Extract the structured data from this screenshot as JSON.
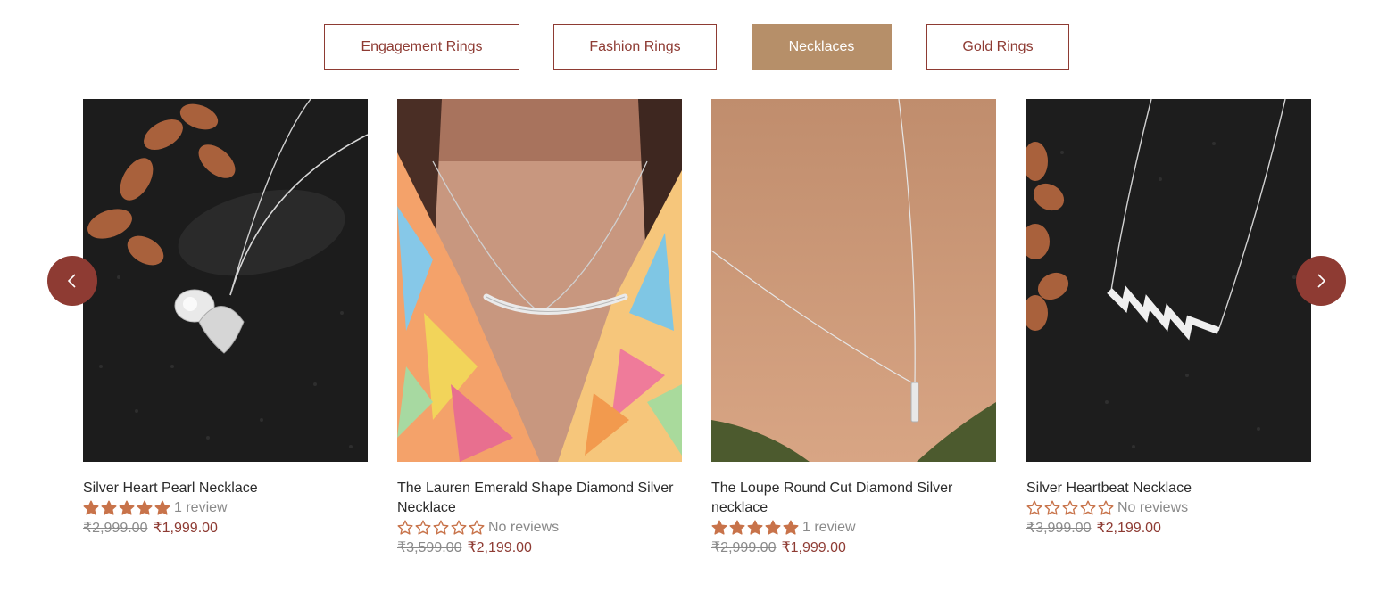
{
  "tabs": [
    {
      "label": "Engagement Rings",
      "active": false
    },
    {
      "label": "Fashion Rings",
      "active": false
    },
    {
      "label": "Necklaces",
      "active": true
    },
    {
      "label": "Gold Rings",
      "active": false
    }
  ],
  "products": [
    {
      "title": "Silver Heart Pearl Necklace",
      "rating": 5,
      "reviews": "1 review",
      "old_price": "₹2,999.00",
      "price": "₹1,999.00"
    },
    {
      "title": "The Lauren Emerald Shape Diamond Silver Necklace",
      "rating": 0,
      "reviews": "No reviews",
      "old_price": "₹3,599.00",
      "price": "₹2,199.00"
    },
    {
      "title": "The Loupe Round Cut Diamond Silver necklace",
      "rating": 5,
      "reviews": "1 review",
      "old_price": "₹2,999.00",
      "price": "₹1,999.00"
    },
    {
      "title": "Silver Heartbeat Necklace",
      "rating": 0,
      "reviews": "No reviews",
      "old_price": "₹3,999.00",
      "price": "₹2,199.00"
    }
  ],
  "icons": {
    "prev": "chevron-left-icon",
    "next": "chevron-right-icon",
    "star": "star-icon"
  },
  "colors": {
    "accent": "#8e3b33",
    "active_tab": "#b68f69",
    "star": "#c8734a"
  }
}
